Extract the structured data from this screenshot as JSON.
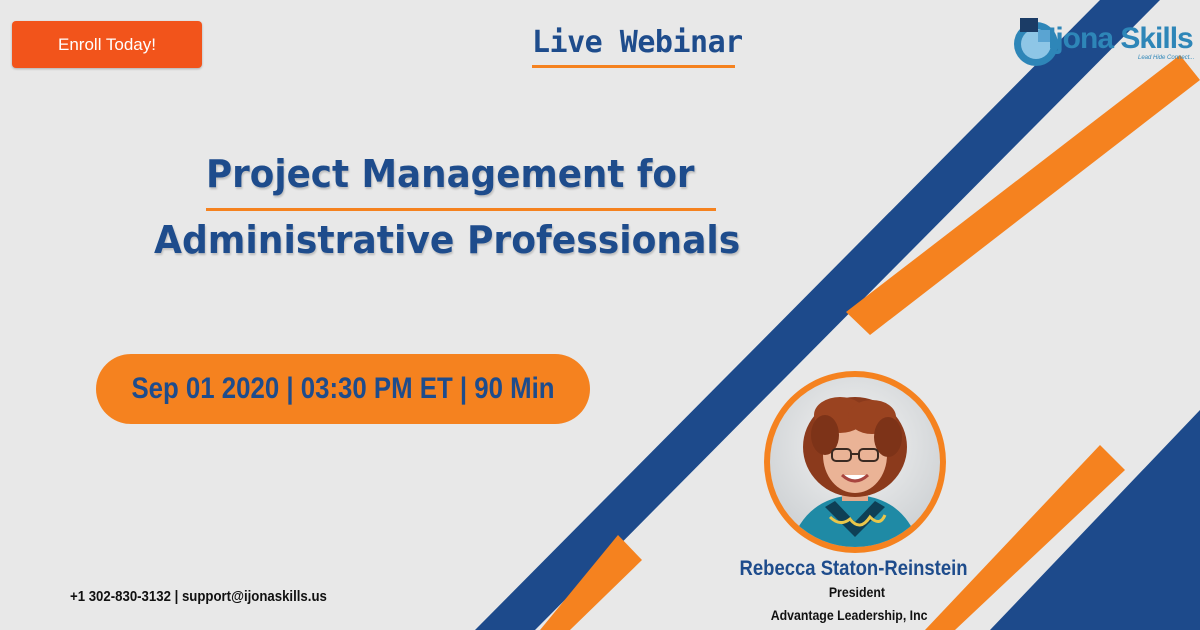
{
  "enroll_button": {
    "label": "Enroll Today!"
  },
  "header": {
    "label": "Live Webinar"
  },
  "logo": {
    "name": "Ijona Skills",
    "tagline": "Lead Hide Connect..."
  },
  "title": {
    "line1": "Project Management for",
    "line2": "Administrative Professionals"
  },
  "schedule": {
    "text": "Sep 01 2020 | 03:30 PM ET | 90 Min"
  },
  "speaker": {
    "name": "Rebecca Staton-Reinstein",
    "role": "President",
    "organization": "Advantage Leadership, Inc"
  },
  "contact": {
    "text": "+1 302-830-3132 | support@ijonaskills.us"
  },
  "colors": {
    "background": "#e8e8e8",
    "brand_blue": "#1e4c8c",
    "accent_orange": "#f5821f",
    "button_orange": "#f2541b",
    "logo_teal": "#2e86b8"
  }
}
